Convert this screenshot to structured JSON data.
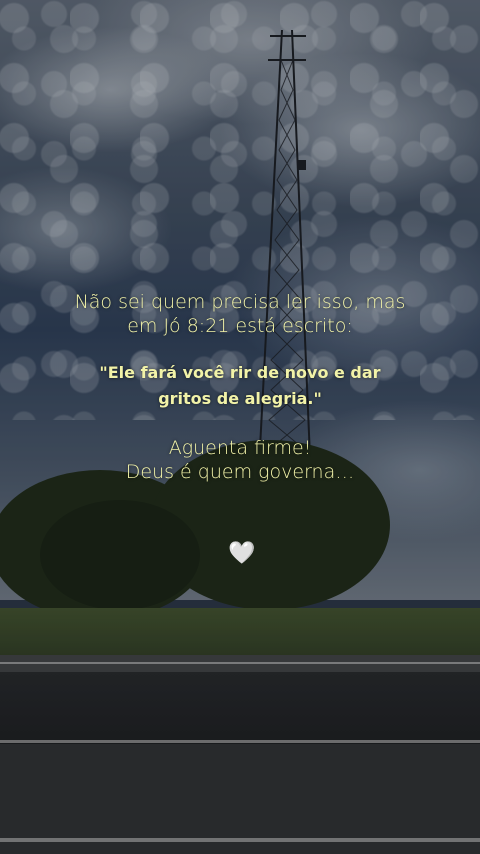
{
  "caption": {
    "intro_line1": "Não sei quem precisa ler isso, mas",
    "intro_line2": "em Jó 8:21 está escrito:",
    "quote_line1": "\"Ele fará você rir de novo e dar",
    "quote_line2": "gritos de alegria.\"",
    "closing_line1": "Aguenta firme!",
    "closing_line2": "Deus é quem governa…"
  },
  "heart": "🤍",
  "colors": {
    "text": "#f2f3a8",
    "sky": "#3d4a5c",
    "tree": "#1f2a1a"
  }
}
